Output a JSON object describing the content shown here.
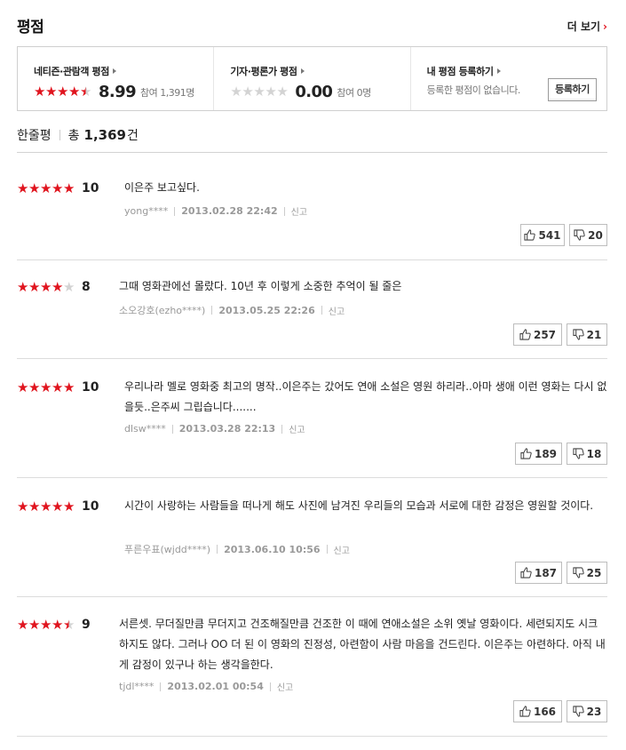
{
  "header": {
    "title": "평점",
    "more_label": "더 보기",
    "more_arrow": "›"
  },
  "scorebox": {
    "netizen": {
      "label": "네티즌·관람객 평점",
      "score": "8.99",
      "participants": "참여 1,391명",
      "stars": [
        1,
        1,
        1,
        1,
        0.5
      ]
    },
    "critic": {
      "label": "기자·평론가 평점",
      "score": "0.00",
      "participants": "참여 0명",
      "stars": [
        0,
        0,
        0,
        0,
        0
      ]
    },
    "mine": {
      "label": "내 평점 등록하기",
      "message": "등록한 평점이 없습니다.",
      "button": "등록하기"
    }
  },
  "summary": {
    "label": "한줄평",
    "total_prefix": "총",
    "total": "1,369",
    "unit": "건"
  },
  "reviews": [
    {
      "stars": [
        1,
        1,
        1,
        1,
        1
      ],
      "score": "10",
      "text": "이은주 보고싶다.",
      "user": "yong****",
      "date": "2013.02.28 22:42",
      "report": "신고",
      "likes": "541",
      "dislikes": "20"
    },
    {
      "stars": [
        1,
        1,
        1,
        1,
        0
      ],
      "score": "8",
      "text": "그때 영화관에선 몰랐다. 10년 후 이렇게 소중한 추억이 될 줄은",
      "user": "소오강호(ezho****)",
      "date": "2013.05.25 22:26",
      "report": "신고",
      "likes": "257",
      "dislikes": "21"
    },
    {
      "stars": [
        1,
        1,
        1,
        1,
        1
      ],
      "score": "10",
      "text": "우리나라 멜로 영화중 최고의 명작..이은주는 갔어도 연애 소설은 영원 하리라..아마 생애 이런 영화는 다시 없을듯..은주씨 그립습니다.......",
      "user": "dlsw****",
      "date": "2013.03.28 22:13",
      "report": "신고",
      "likes": "189",
      "dislikes": "18"
    },
    {
      "stars": [
        1,
        1,
        1,
        1,
        1
      ],
      "score": "10",
      "text": "시간이 사랑하는 사람들을 떠나게 해도 사진에 남겨진 우리들의 모습과 서로에 대한 감정은 영원할 것이다.",
      "user": "푸른우표(wjdd****)",
      "date": "2013.06.10 10:56",
      "report": "신고",
      "likes": "187",
      "dislikes": "25"
    },
    {
      "stars": [
        1,
        1,
        1,
        1,
        0.5
      ],
      "score": "9",
      "text": "서른셋. 무더질만큼 무더지고 건조해질만큼 건조한 이 때에 연애소설은 소위 옛날 영화이다. 세련되지도 시크하지도 않다. 그러나 OO 더 된 이 영화의 진정성, 아련함이 사람 마음을 건드린다. 이은주는 아련하다. 아직 내게 감정이 있구나 하는 생각을한다.",
      "user": "tjdl****",
      "date": "2013.02.01 00:54",
      "report": "신고",
      "likes": "166",
      "dislikes": "23"
    }
  ]
}
